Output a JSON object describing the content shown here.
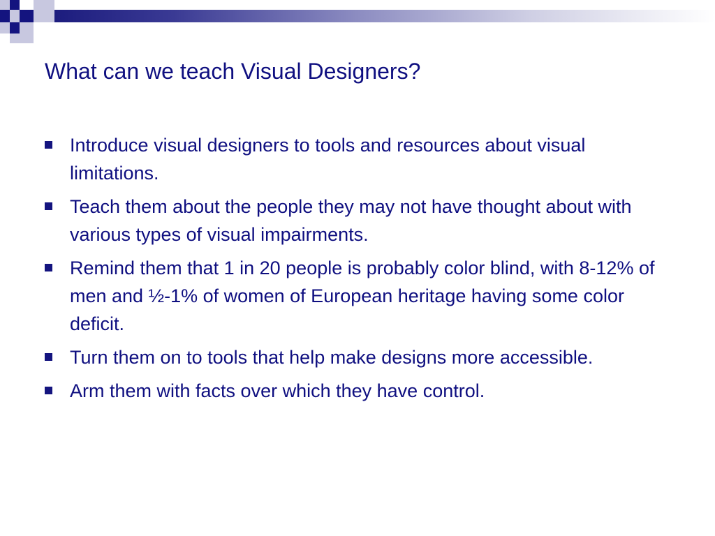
{
  "slide": {
    "title": "What can we teach Visual Designers?",
    "bullets": [
      {
        "text": "Introduce visual designers to tools and resources about visual limitations."
      },
      {
        "text": "Teach them about the people they may not have thought about with various types of visual impairments."
      },
      {
        "text": "Remind them that 1 in 20 people is probably color blind, with 8-12% of men and ½-1% of women of European heritage having some color deficit."
      },
      {
        "text": "Turn them on to tools that help make designs more accessible."
      },
      {
        "text": "Arm them with facts over which they have control."
      }
    ]
  },
  "colors": {
    "text": "#0f0f80",
    "accent_dark": "#14147f",
    "accent_mid": "#5a5aa8",
    "accent_light": "#c8c8e0",
    "background": "#ffffff"
  },
  "icons": {
    "bullet": "square-bullet-icon",
    "header": "checker-squares-decoration"
  }
}
